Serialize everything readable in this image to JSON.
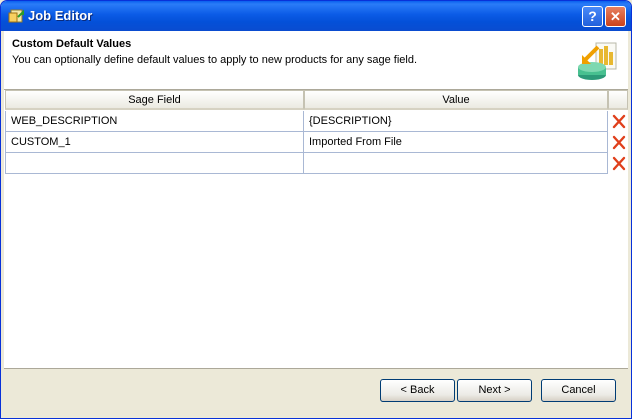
{
  "window": {
    "title": "Job Editor",
    "help_label": "?",
    "close_label": "✕"
  },
  "header": {
    "title": "Custom Default Values",
    "subtitle": "You can optionally define default values to apply to new products for any sage field."
  },
  "grid": {
    "columns": [
      "Sage Field",
      "Value"
    ],
    "rows": [
      {
        "field": "WEB_DESCRIPTION",
        "value": "{DESCRIPTION}"
      },
      {
        "field": "CUSTOM_1",
        "value": "Imported From File"
      },
      {
        "field": "",
        "value": ""
      }
    ]
  },
  "footer": {
    "back_label": "< Back",
    "next_label": "Next >",
    "cancel_label": "Cancel"
  },
  "colors": {
    "titlebar": "#0A5FEF",
    "delete_icon": "#E0401C",
    "grid_line": "#A9B8D4"
  }
}
